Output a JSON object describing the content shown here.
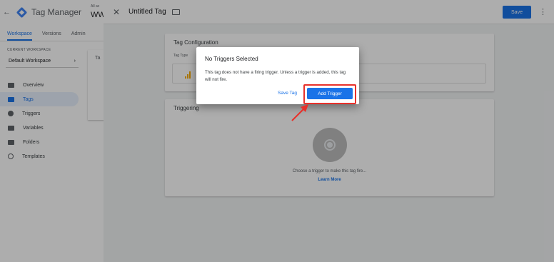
{
  "background": {
    "app_title": "Tag Manager",
    "account_label": "All ac",
    "container_name": "WW",
    "tabs": [
      {
        "label": "Workspace",
        "active": true
      },
      {
        "label": "Versions",
        "active": false
      },
      {
        "label": "Admin",
        "active": false
      }
    ],
    "workspace_label": "CURRENT WORKSPACE",
    "workspace_name": "Default Workspace",
    "nav": [
      {
        "label": "Overview",
        "icon": "folder-icon",
        "active": false
      },
      {
        "label": "Tags",
        "icon": "tag-icon",
        "active": true
      },
      {
        "label": "Triggers",
        "icon": "trigger-icon",
        "active": false
      },
      {
        "label": "Variables",
        "icon": "variable-icon",
        "active": false
      },
      {
        "label": "Folders",
        "icon": "folder-icon",
        "active": false
      },
      {
        "label": "Templates",
        "icon": "template-icon",
        "active": false
      }
    ],
    "card_fragment": "Ta"
  },
  "editor": {
    "title": "Untitled Tag",
    "save_label": "Save",
    "config_title": "Tag Configuration",
    "tag_type_label": "Tag Type",
    "triggering_title": "Triggering",
    "trigger_prompt": "Choose a trigger to make this tag fire...",
    "learn_more": "Learn More"
  },
  "dialog": {
    "title": "No Triggers Selected",
    "message": "This tag does not have a firing trigger. Unless a trigger is added, this tag will not fire.",
    "save_tag_label": "Save Tag",
    "add_trigger_label": "Add Trigger"
  },
  "colors": {
    "accent": "#1a73e8",
    "annotation": "#e8312b"
  }
}
